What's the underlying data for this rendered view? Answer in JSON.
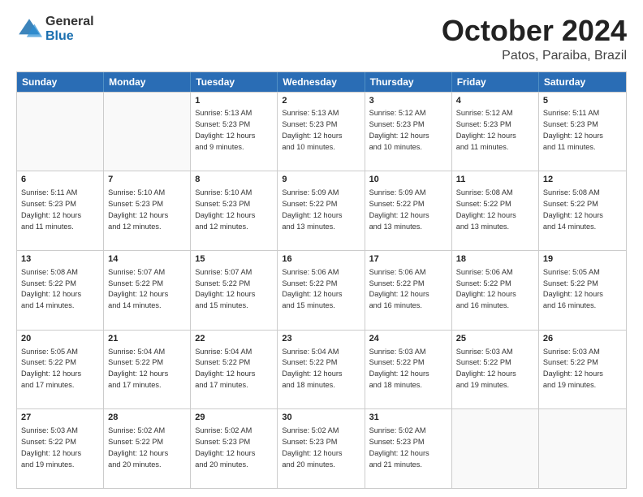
{
  "logo": {
    "general": "General",
    "blue": "Blue"
  },
  "title": "October 2024",
  "location": "Patos, Paraiba, Brazil",
  "days": [
    "Sunday",
    "Monday",
    "Tuesday",
    "Wednesday",
    "Thursday",
    "Friday",
    "Saturday"
  ],
  "weeks": [
    [
      {
        "day": "",
        "info": ""
      },
      {
        "day": "",
        "info": ""
      },
      {
        "day": "1",
        "info": "Sunrise: 5:13 AM\nSunset: 5:23 PM\nDaylight: 12 hours\nand 9 minutes."
      },
      {
        "day": "2",
        "info": "Sunrise: 5:13 AM\nSunset: 5:23 PM\nDaylight: 12 hours\nand 10 minutes."
      },
      {
        "day": "3",
        "info": "Sunrise: 5:12 AM\nSunset: 5:23 PM\nDaylight: 12 hours\nand 10 minutes."
      },
      {
        "day": "4",
        "info": "Sunrise: 5:12 AM\nSunset: 5:23 PM\nDaylight: 12 hours\nand 11 minutes."
      },
      {
        "day": "5",
        "info": "Sunrise: 5:11 AM\nSunset: 5:23 PM\nDaylight: 12 hours\nand 11 minutes."
      }
    ],
    [
      {
        "day": "6",
        "info": "Sunrise: 5:11 AM\nSunset: 5:23 PM\nDaylight: 12 hours\nand 11 minutes."
      },
      {
        "day": "7",
        "info": "Sunrise: 5:10 AM\nSunset: 5:23 PM\nDaylight: 12 hours\nand 12 minutes."
      },
      {
        "day": "8",
        "info": "Sunrise: 5:10 AM\nSunset: 5:23 PM\nDaylight: 12 hours\nand 12 minutes."
      },
      {
        "day": "9",
        "info": "Sunrise: 5:09 AM\nSunset: 5:22 PM\nDaylight: 12 hours\nand 13 minutes."
      },
      {
        "day": "10",
        "info": "Sunrise: 5:09 AM\nSunset: 5:22 PM\nDaylight: 12 hours\nand 13 minutes."
      },
      {
        "day": "11",
        "info": "Sunrise: 5:08 AM\nSunset: 5:22 PM\nDaylight: 12 hours\nand 13 minutes."
      },
      {
        "day": "12",
        "info": "Sunrise: 5:08 AM\nSunset: 5:22 PM\nDaylight: 12 hours\nand 14 minutes."
      }
    ],
    [
      {
        "day": "13",
        "info": "Sunrise: 5:08 AM\nSunset: 5:22 PM\nDaylight: 12 hours\nand 14 minutes."
      },
      {
        "day": "14",
        "info": "Sunrise: 5:07 AM\nSunset: 5:22 PM\nDaylight: 12 hours\nand 14 minutes."
      },
      {
        "day": "15",
        "info": "Sunrise: 5:07 AM\nSunset: 5:22 PM\nDaylight: 12 hours\nand 15 minutes."
      },
      {
        "day": "16",
        "info": "Sunrise: 5:06 AM\nSunset: 5:22 PM\nDaylight: 12 hours\nand 15 minutes."
      },
      {
        "day": "17",
        "info": "Sunrise: 5:06 AM\nSunset: 5:22 PM\nDaylight: 12 hours\nand 16 minutes."
      },
      {
        "day": "18",
        "info": "Sunrise: 5:06 AM\nSunset: 5:22 PM\nDaylight: 12 hours\nand 16 minutes."
      },
      {
        "day": "19",
        "info": "Sunrise: 5:05 AM\nSunset: 5:22 PM\nDaylight: 12 hours\nand 16 minutes."
      }
    ],
    [
      {
        "day": "20",
        "info": "Sunrise: 5:05 AM\nSunset: 5:22 PM\nDaylight: 12 hours\nand 17 minutes."
      },
      {
        "day": "21",
        "info": "Sunrise: 5:04 AM\nSunset: 5:22 PM\nDaylight: 12 hours\nand 17 minutes."
      },
      {
        "day": "22",
        "info": "Sunrise: 5:04 AM\nSunset: 5:22 PM\nDaylight: 12 hours\nand 17 minutes."
      },
      {
        "day": "23",
        "info": "Sunrise: 5:04 AM\nSunset: 5:22 PM\nDaylight: 12 hours\nand 18 minutes."
      },
      {
        "day": "24",
        "info": "Sunrise: 5:03 AM\nSunset: 5:22 PM\nDaylight: 12 hours\nand 18 minutes."
      },
      {
        "day": "25",
        "info": "Sunrise: 5:03 AM\nSunset: 5:22 PM\nDaylight: 12 hours\nand 19 minutes."
      },
      {
        "day": "26",
        "info": "Sunrise: 5:03 AM\nSunset: 5:22 PM\nDaylight: 12 hours\nand 19 minutes."
      }
    ],
    [
      {
        "day": "27",
        "info": "Sunrise: 5:03 AM\nSunset: 5:22 PM\nDaylight: 12 hours\nand 19 minutes."
      },
      {
        "day": "28",
        "info": "Sunrise: 5:02 AM\nSunset: 5:22 PM\nDaylight: 12 hours\nand 20 minutes."
      },
      {
        "day": "29",
        "info": "Sunrise: 5:02 AM\nSunset: 5:23 PM\nDaylight: 12 hours\nand 20 minutes."
      },
      {
        "day": "30",
        "info": "Sunrise: 5:02 AM\nSunset: 5:23 PM\nDaylight: 12 hours\nand 20 minutes."
      },
      {
        "day": "31",
        "info": "Sunrise: 5:02 AM\nSunset: 5:23 PM\nDaylight: 12 hours\nand 21 minutes."
      },
      {
        "day": "",
        "info": ""
      },
      {
        "day": "",
        "info": ""
      }
    ]
  ]
}
